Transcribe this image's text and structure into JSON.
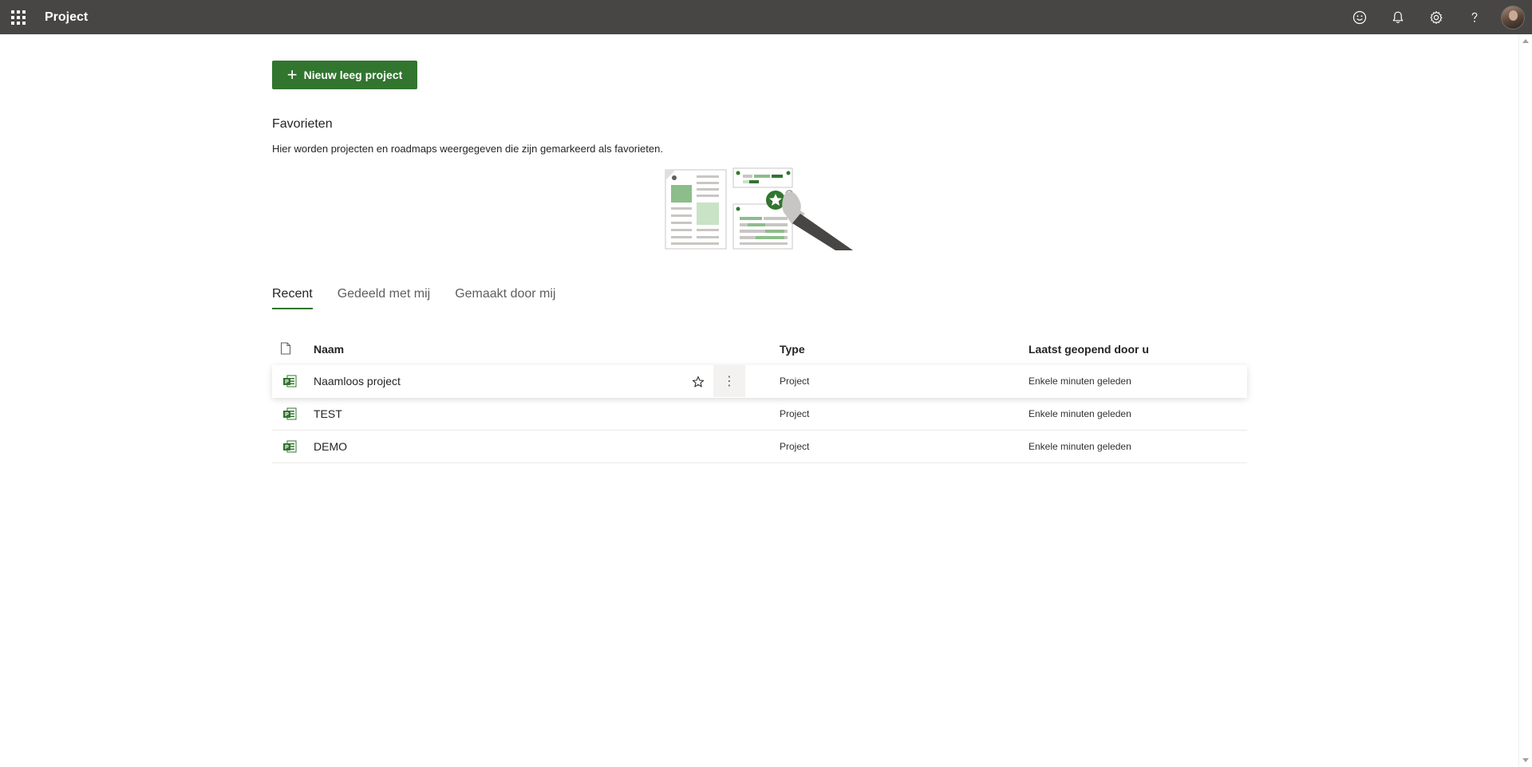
{
  "suitebar": {
    "app_title": "Project",
    "icons": [
      "app-launcher-icon",
      "feedback-smiley-icon",
      "bell-icon",
      "gear-icon",
      "help-icon",
      "avatar"
    ]
  },
  "main": {
    "new_button_label": "Nieuw leeg project",
    "favorites": {
      "title": "Favorieten",
      "description": "Hier worden projecten en roadmaps weergegeven die zijn gemarkeerd als favorieten."
    },
    "tabs": [
      {
        "label": "Recent",
        "active": true
      },
      {
        "label": "Gedeeld met mij",
        "active": false
      },
      {
        "label": "Gemaakt door mij",
        "active": false
      }
    ],
    "table": {
      "headers": {
        "name": "Naam",
        "type": "Type",
        "last_opened": "Laatst geopend door u"
      },
      "rows": [
        {
          "name": "Naamloos project",
          "type": "Project",
          "last_opened": "Enkele minuten geleden"
        },
        {
          "name": "TEST",
          "type": "Project",
          "last_opened": "Enkele minuten geleden"
        },
        {
          "name": "DEMO",
          "type": "Project",
          "last_opened": "Enkele minuten geleden"
        }
      ]
    }
  },
  "colors": {
    "suitebar_bg": "#484644",
    "accent_green": "#31752f",
    "text": "#252423",
    "muted_text": "#605e5c"
  }
}
